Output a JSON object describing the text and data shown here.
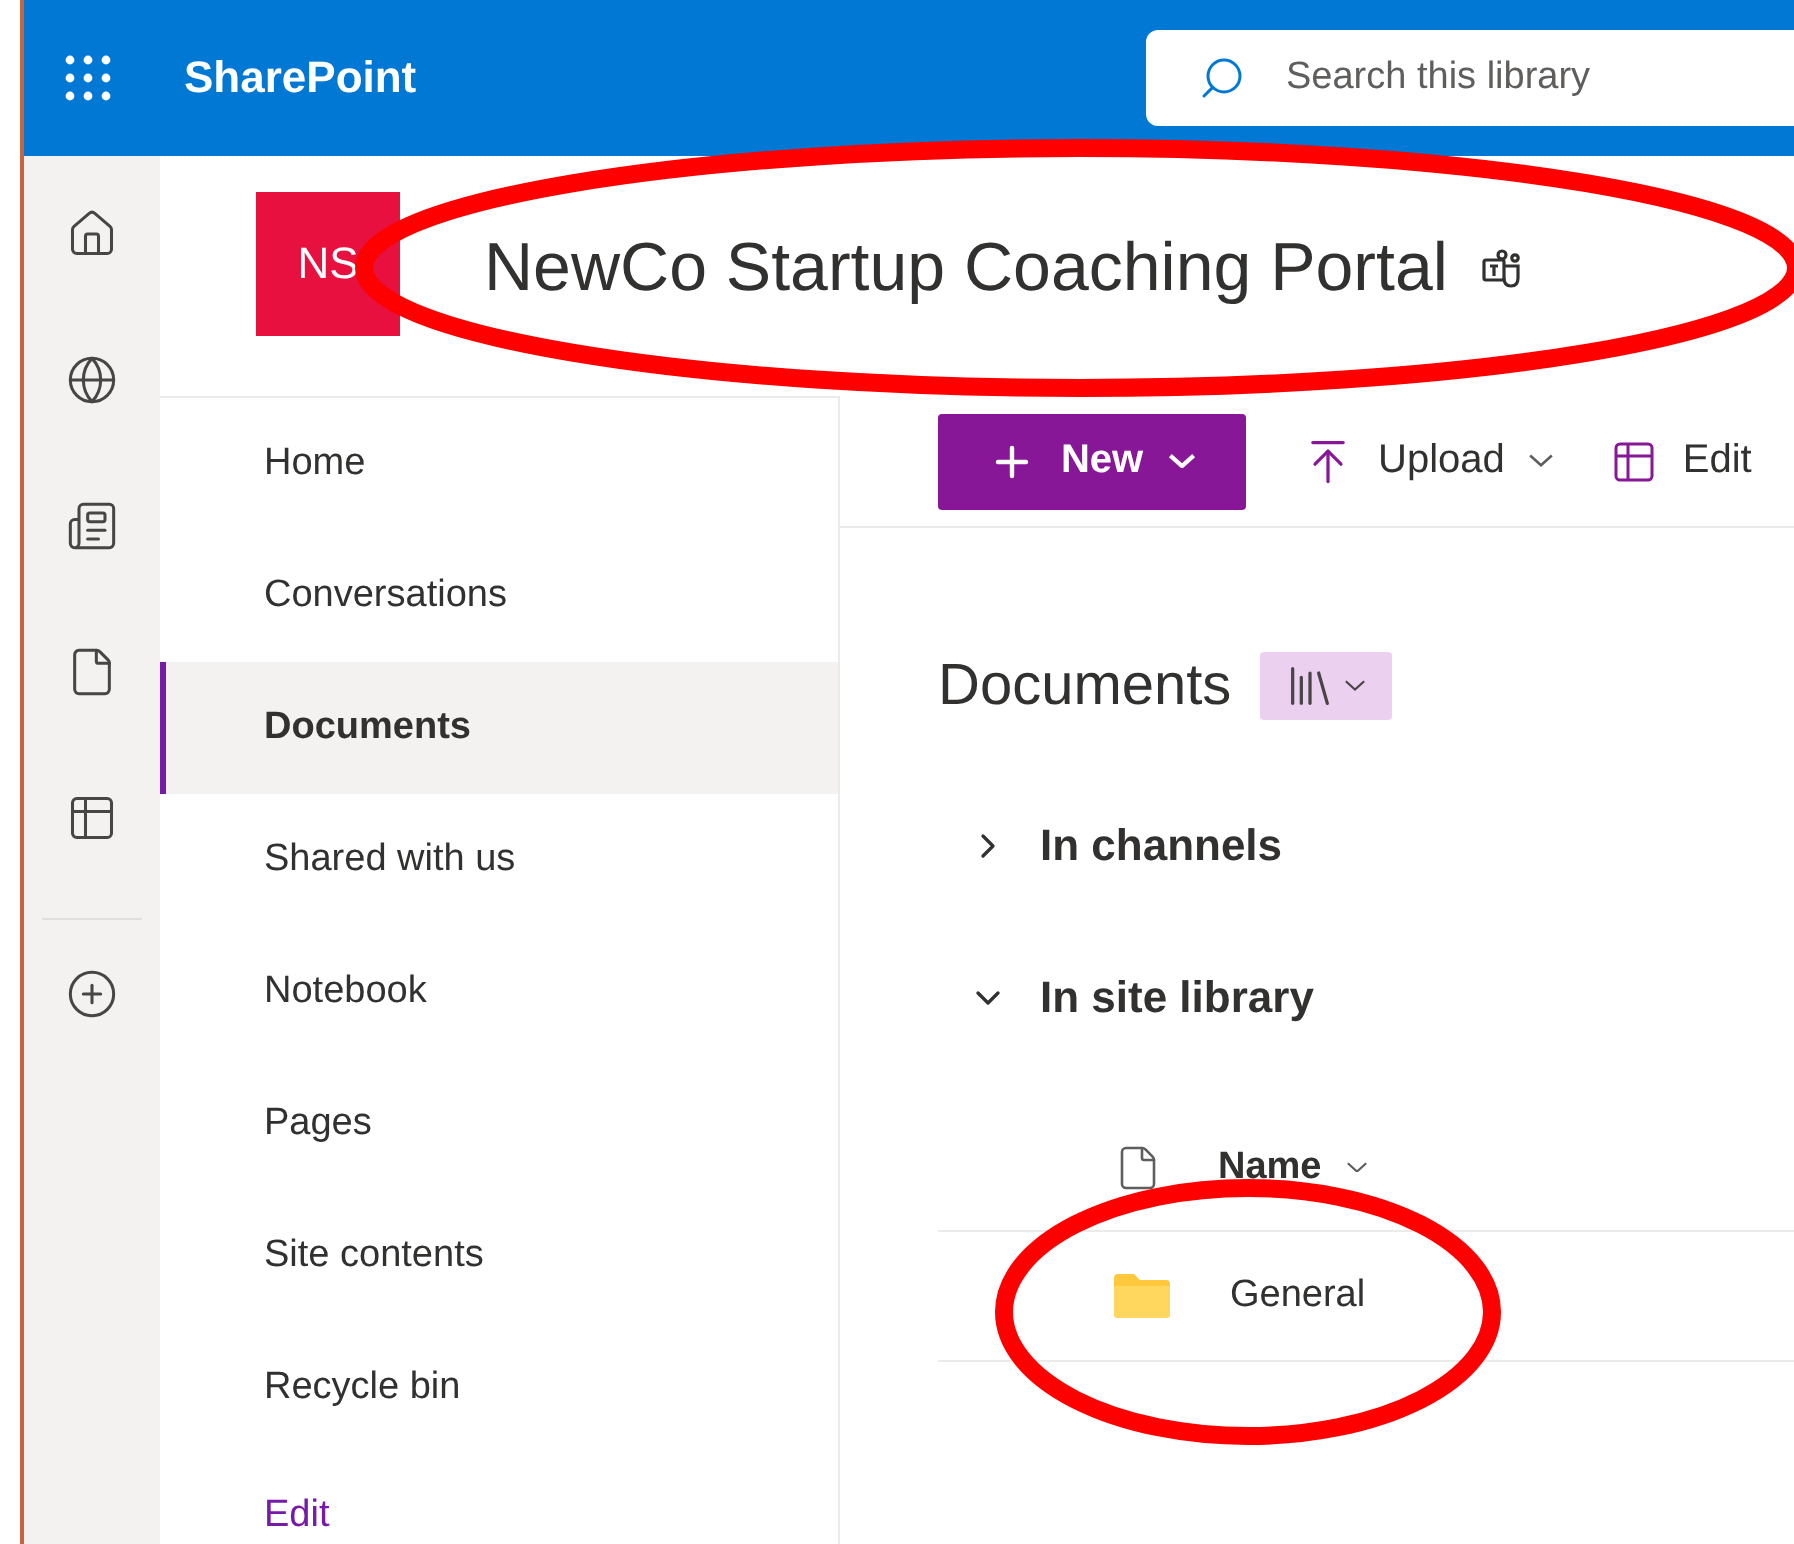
{
  "app_bar": {
    "app_name": "SharePoint",
    "search": {
      "placeholder": "Search this library"
    }
  },
  "site": {
    "logo": "NS",
    "title": "NewCo Startup Coaching Portal"
  },
  "nav": {
    "items": [
      {
        "label": "Home",
        "selected": false
      },
      {
        "label": "Conversations",
        "selected": false
      },
      {
        "label": "Documents",
        "selected": true
      },
      {
        "label": "Shared with us",
        "selected": false
      },
      {
        "label": "Notebook",
        "selected": false
      },
      {
        "label": "Pages",
        "selected": false
      },
      {
        "label": "Site contents",
        "selected": false
      },
      {
        "label": "Recycle bin",
        "selected": false
      }
    ],
    "edit_link": "Edit"
  },
  "command_bar": {
    "new": "New",
    "upload": "Upload",
    "edit": "Edit"
  },
  "library": {
    "title": "Documents",
    "sections": [
      {
        "label": "In channels",
        "expanded": false
      },
      {
        "label": "In site library",
        "expanded": true
      }
    ],
    "columns": [
      "Name"
    ],
    "rows": [
      {
        "name": "General",
        "kind": "folder"
      }
    ]
  },
  "annotations": [
    {
      "kind": "ellipse"
    },
    {
      "kind": "ellipse"
    }
  ]
}
